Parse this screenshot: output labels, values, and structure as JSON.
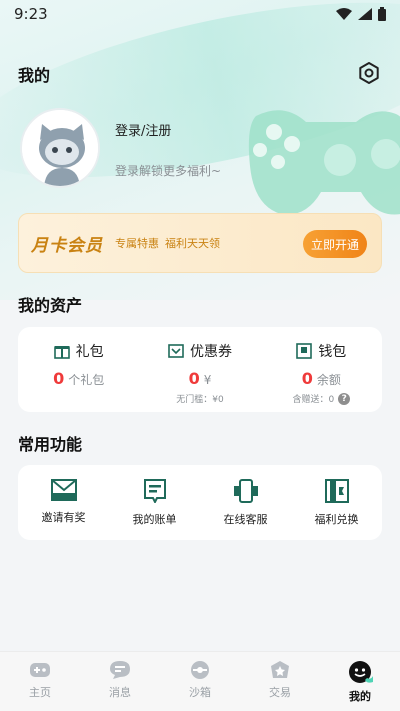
{
  "status_bar": {
    "time": "9:23"
  },
  "header": {
    "title": "我的"
  },
  "profile": {
    "login_label": "登录/注册",
    "subtitle": "登录解锁更多福利~"
  },
  "vip": {
    "title": "月卡会员",
    "tag1": "专属特惠",
    "tag2": "福利天天领",
    "button_label": "立即开通"
  },
  "assets": {
    "title": "我的资产",
    "items": [
      {
        "label": "礼包",
        "value": "0",
        "unit": "个礼包",
        "note": ""
      },
      {
        "label": "优惠券",
        "value": "0",
        "unit": "¥",
        "note": "无门槛：¥0"
      },
      {
        "label": "钱包",
        "value": "0",
        "unit": "余额",
        "note": "含赠送：0"
      }
    ]
  },
  "functions": {
    "title": "常用功能",
    "items": [
      {
        "label": "邀请有奖"
      },
      {
        "label": "我的账单"
      },
      {
        "label": "在线客服"
      },
      {
        "label": "福利兑换"
      }
    ]
  },
  "tabs": [
    {
      "label": "主页",
      "active": false
    },
    {
      "label": "消息",
      "active": false
    },
    {
      "label": "沙箱",
      "active": false
    },
    {
      "label": "交易",
      "active": false
    },
    {
      "label": "我的",
      "active": true
    }
  ],
  "colors": {
    "accent_red": "#ef3a3a",
    "vip_gold": "#c98212",
    "vip_button": "#f08418",
    "hero_mint": "#dff3f1"
  }
}
